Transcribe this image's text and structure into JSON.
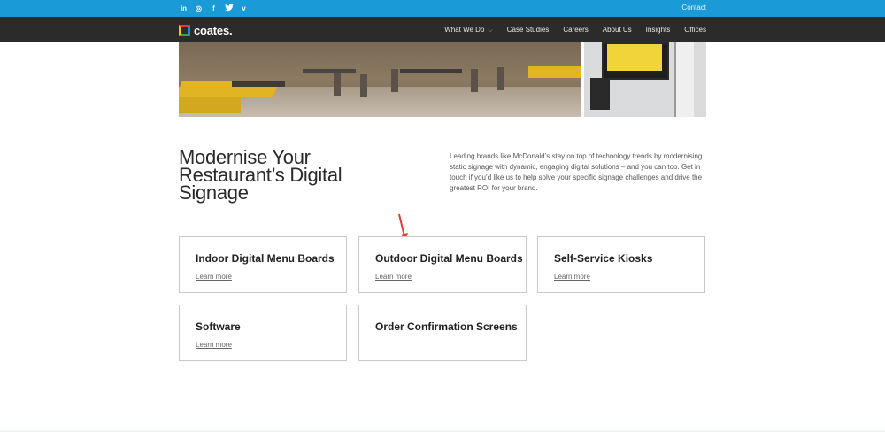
{
  "topbar": {
    "social": [
      {
        "name": "linkedin-icon",
        "glyph": "in"
      },
      {
        "name": "instagram-icon",
        "glyph": "◎"
      },
      {
        "name": "facebook-icon",
        "glyph": "f"
      },
      {
        "name": "twitter-icon",
        "glyph": "🐦"
      },
      {
        "name": "vimeo-icon",
        "glyph": "v"
      }
    ],
    "contact_label": "Contact",
    "color": "#1a9ad6"
  },
  "nav": {
    "logo_text": "coates.",
    "items": [
      "What We Do",
      "Case Studies",
      "Careers",
      "About Us",
      "Insights",
      "Offices"
    ],
    "dropdown_icon": "chevron-down-icon"
  },
  "main": {
    "heading_lines": [
      "Modernise Your",
      "Restaurant’s Digital",
      "Signage"
    ],
    "intro": "Leading brands like McDonald’s stay on top of technology trends by modernising static signage with dynamic, engaging digital solutions – and you can too. Get in touch if you’d like us to help solve your specific signage challenges and drive the greatest ROI for your brand."
  },
  "cards": [
    {
      "title": "Indoor Digital Menu Boards",
      "link": "Learn more"
    },
    {
      "title": "Outdoor Digital Menu Boards",
      "link": "Learn more"
    },
    {
      "title": "Self-Service Kiosks",
      "link": "Learn more"
    },
    {
      "title": "Software",
      "link": "Learn more"
    },
    {
      "title": "Order Confirmation Screens",
      "link": ""
    }
  ],
  "annotation": {
    "arrow_color": "#e53935"
  }
}
